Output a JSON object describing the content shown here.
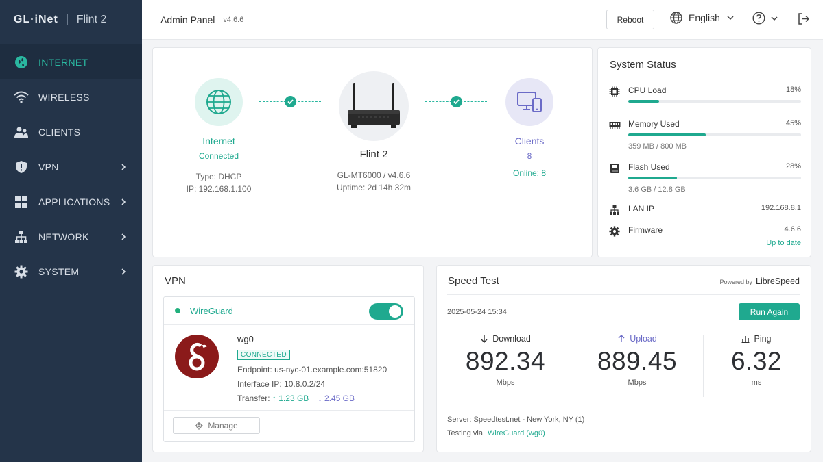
{
  "brand": {
    "logo": "GL·iNet",
    "model": "Flint 2"
  },
  "nav": {
    "items": [
      {
        "label": "INTERNET",
        "icon": "globe-icon"
      },
      {
        "label": "WIRELESS",
        "icon": "wifi-icon"
      },
      {
        "label": "CLIENTS",
        "icon": "users-icon"
      },
      {
        "label": "VPN",
        "icon": "shield-icon"
      },
      {
        "label": "APPLICATIONS",
        "icon": "grid-icon"
      },
      {
        "label": "NETWORK",
        "icon": "network-icon"
      },
      {
        "label": "SYSTEM",
        "icon": "gear-icon"
      }
    ]
  },
  "header": {
    "title": "Admin Panel",
    "version": "v4.6.6",
    "reboot_label": "Reboot",
    "language": "English"
  },
  "topology": {
    "internet": {
      "label": "Internet",
      "status": "Connected",
      "type": "Type: DHCP",
      "ip": "IP: 192.168.1.100"
    },
    "router": {
      "label": "Flint 2",
      "model": "GL-MT6000 / v4.6.6",
      "uptime": "Uptime: 2d 14h 32m"
    },
    "clients": {
      "label": "Clients",
      "count": "8",
      "online": "Online: 8"
    }
  },
  "system_status": {
    "title": "System Status",
    "cpu": {
      "label": "CPU Load",
      "value": "18%",
      "percent": 18
    },
    "memory": {
      "label": "Memory Used",
      "value": "45%",
      "percent": 45,
      "detail": "359 MB / 800 MB"
    },
    "flash": {
      "label": "Flash Used",
      "value": "28%",
      "percent": 28,
      "detail": "3.6 GB / 12.8 GB"
    },
    "lan": {
      "label": "LAN IP",
      "value": "192.168.8.1"
    },
    "firmware": {
      "label": "Firmware",
      "value": "4.6.6",
      "note": "Up to date"
    }
  },
  "vpn": {
    "title": "VPN",
    "protocol": "WireGuard",
    "enabled": true,
    "name": "wg0",
    "status": "CONNECTED",
    "endpoint_label": "Endpoint:",
    "endpoint": "us-nyc-01.example.com:51820",
    "interface_label": "Interface IP:",
    "interface_ip": "10.8.0.2/24",
    "transfer_label": "Transfer:",
    "upload": "↑ 1.23 GB",
    "download": "↓ 2.45 GB",
    "manage_label": "Manage"
  },
  "speed_test": {
    "title": "Speed Test",
    "powered_by": "Powered by",
    "provider": "LibreSpeed",
    "date": "2025-05-24 15:34",
    "run_label": "Run Again",
    "download": {
      "label": "Download",
      "value": "892.34",
      "unit": "Mbps"
    },
    "upload": {
      "label": "Upload",
      "value": "889.45",
      "unit": "Mbps"
    },
    "ping": {
      "label": "Ping",
      "value": "6.32",
      "unit": "ms"
    },
    "server": "Server: Speedtest.net - New York, NY (1)",
    "via_label": "Testing via",
    "via": "WireGuard (wg0)"
  },
  "colors": {
    "accent": "#1fa98f",
    "sidebar": "#243449",
    "clients": "#6b6bc7",
    "wireguard": "#8b1a1a"
  }
}
